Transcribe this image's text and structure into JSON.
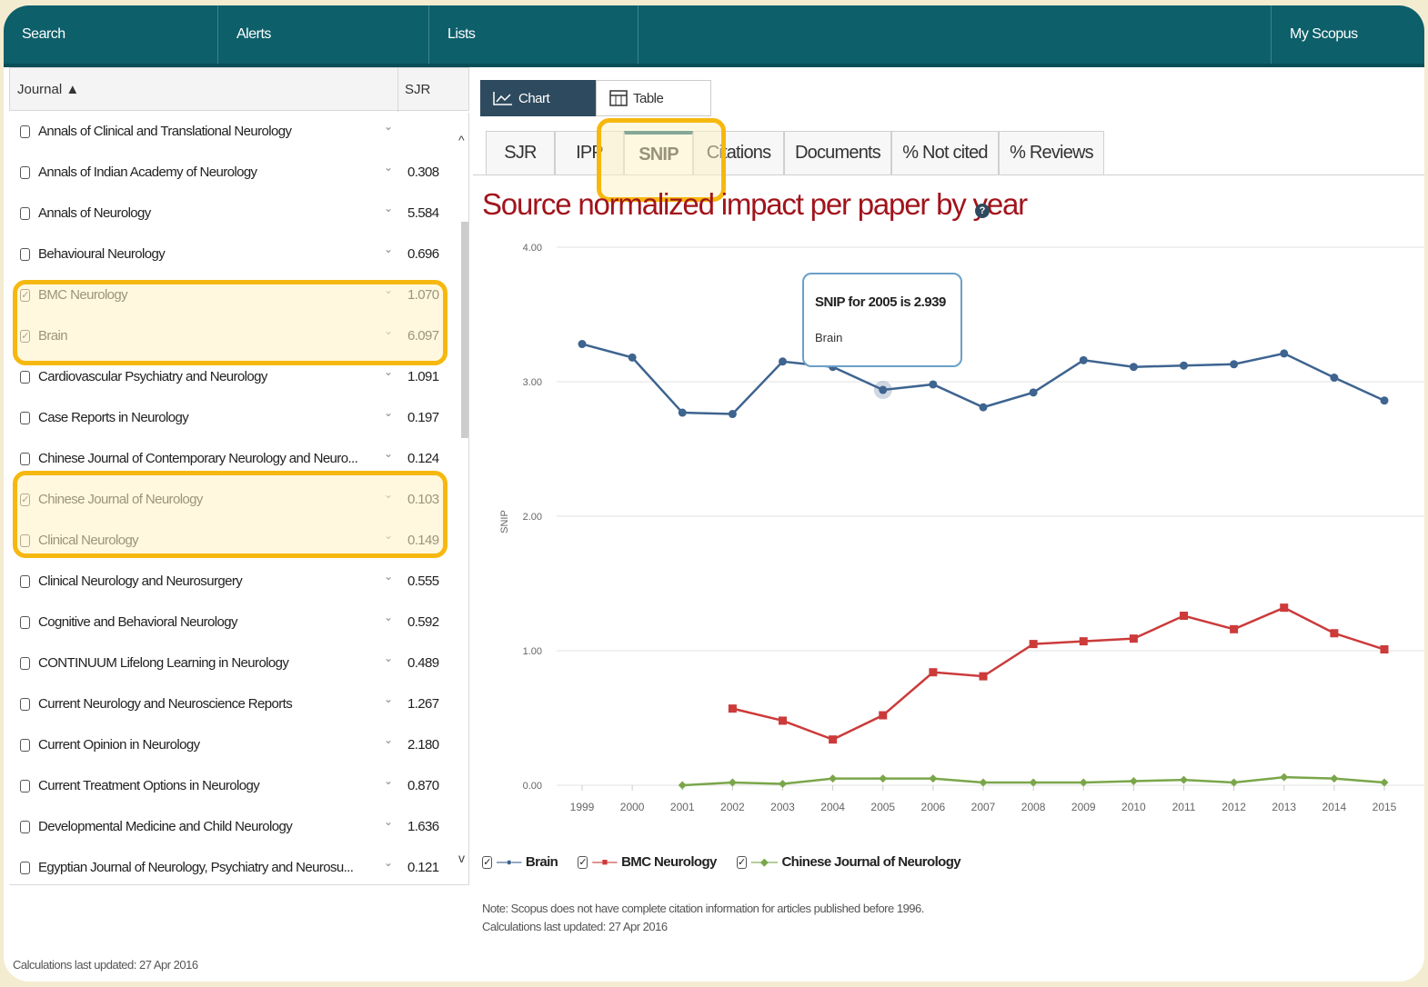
{
  "nav": {
    "items": [
      "Search",
      "Alerts",
      "Lists",
      "",
      "My Scopus"
    ]
  },
  "journal_list": {
    "header_journal": "Journal ▲",
    "header_sjr": "SJR",
    "rows": [
      {
        "name": "Annals of Clinical and Translational Neurology",
        "value": "",
        "checked": false
      },
      {
        "name": "Annals of Indian Academy of Neurology",
        "value": "0.308",
        "checked": false
      },
      {
        "name": "Annals of Neurology",
        "value": "5.584",
        "checked": false
      },
      {
        "name": "Behavioural Neurology",
        "value": "0.696",
        "checked": false
      },
      {
        "name": "BMC Neurology",
        "value": "1.070",
        "checked": true
      },
      {
        "name": "Brain",
        "value": "6.097",
        "checked": true
      },
      {
        "name": "Cardiovascular Psychiatry and Neurology",
        "value": "1.091",
        "checked": false
      },
      {
        "name": "Case Reports in Neurology",
        "value": "0.197",
        "checked": false
      },
      {
        "name": "Chinese Journal of Contemporary Neurology and Neuro...",
        "value": "0.124",
        "checked": false
      },
      {
        "name": "Chinese Journal of Neurology",
        "value": "0.103",
        "checked": true
      },
      {
        "name": "Clinical Neurology",
        "value": "0.149",
        "checked": false
      },
      {
        "name": "Clinical Neurology and Neurosurgery",
        "value": "0.555",
        "checked": false
      },
      {
        "name": "Cognitive and Behavioral Neurology",
        "value": "0.592",
        "checked": false
      },
      {
        "name": "CONTINUUM Lifelong Learning in Neurology",
        "value": "0.489",
        "checked": false
      },
      {
        "name": "Current Neurology and Neuroscience Reports",
        "value": "1.267",
        "checked": false
      },
      {
        "name": "Current Opinion in Neurology",
        "value": "2.180",
        "checked": false
      },
      {
        "name": "Current Treatment Options in Neurology",
        "value": "0.870",
        "checked": false
      },
      {
        "name": "Developmental Medicine and Child Neurology",
        "value": "1.636",
        "checked": false
      },
      {
        "name": "Egyptian Journal of Neurology, Psychiatry and Neurosu...",
        "value": "0.121",
        "checked": false
      }
    ],
    "footer": "Calculations last updated: 27 Apr 2016"
  },
  "view_toggle": {
    "chart": "Chart",
    "table": "Table"
  },
  "tabs": [
    "SJR",
    "IPP",
    "SNIP",
    "Citations",
    "Documents",
    "% Not cited",
    "% Reviews"
  ],
  "active_tab": "SNIP",
  "chart_title": "Source normalized impact per paper by year",
  "tooltip": {
    "title": "SNIP for 2005 is 2.939",
    "series": "Brain"
  },
  "chart_data": {
    "type": "line",
    "ylabel": "SNIP",
    "xlabel": "",
    "ylim": [
      0,
      4
    ],
    "yticks": [
      "0.00",
      "1.00",
      "2.00",
      "3.00",
      "4.00"
    ],
    "x": [
      "1999",
      "2000",
      "2001",
      "2002",
      "2003",
      "2004",
      "2005",
      "2006",
      "2007",
      "2008",
      "2009",
      "2010",
      "2011",
      "2012",
      "2013",
      "2014",
      "2015"
    ],
    "series": [
      {
        "name": "Brain",
        "color": "#3e6490",
        "marker": "circle",
        "values": [
          3.28,
          3.18,
          2.77,
          2.76,
          3.15,
          3.11,
          2.939,
          2.98,
          2.81,
          2.92,
          3.16,
          3.11,
          3.12,
          3.13,
          3.21,
          3.03,
          2.86
        ]
      },
      {
        "name": "BMC Neurology",
        "color": "#cc3a3a",
        "marker": "square",
        "values": [
          null,
          null,
          null,
          0.57,
          0.48,
          0.34,
          0.52,
          0.84,
          0.81,
          1.05,
          1.07,
          1.09,
          1.26,
          1.16,
          1.32,
          1.13,
          1.01
        ]
      },
      {
        "name": "Chinese Journal of Neurology",
        "color": "#7aa64a",
        "marker": "diamond",
        "values": [
          null,
          null,
          0.0,
          0.02,
          0.01,
          0.05,
          0.05,
          0.05,
          0.02,
          0.02,
          0.02,
          0.03,
          0.04,
          0.02,
          0.06,
          0.05,
          0.02
        ]
      }
    ],
    "tooltip_point": {
      "series": "Brain",
      "x": "2005",
      "y": 2.939
    },
    "legend": "bottom-left",
    "grid": true
  },
  "note": [
    "Note: Scopus does not have complete citation information for articles published before 1996.",
    "Calculations last updated: 27 Apr 2016"
  ],
  "colors": {
    "nav": "#0d5f6a",
    "highlight": "#f6b810",
    "title": "#a1141c"
  }
}
